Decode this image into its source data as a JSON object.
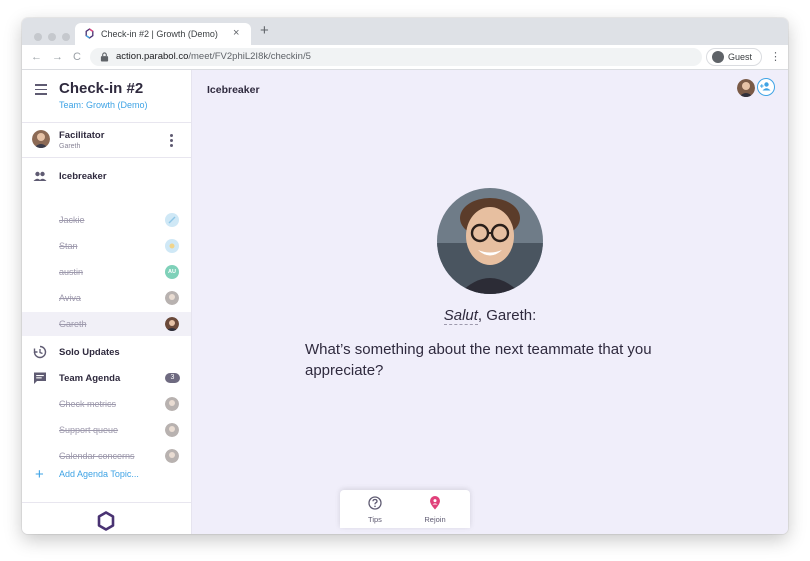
{
  "browser": {
    "tab_title": "Check-in #2 | Growth (Demo)",
    "tab_close": "×",
    "new_tab": "+",
    "back": "←",
    "forward": "→",
    "reload": "C",
    "url_host": "action.parabol.co",
    "url_path": "/meet/FV2phiL2I8k/checkin/5",
    "profile_label": "Guest",
    "menu": "⋮"
  },
  "sidebar": {
    "meeting_title": "Check-in #2",
    "team_name": "Team: Growth (Demo)",
    "facilitator_label": "Facilitator",
    "facilitator_name": "Gareth",
    "phases": {
      "icebreaker": "Icebreaker",
      "solo_updates": "Solo Updates",
      "team_agenda": "Team Agenda",
      "team_agenda_count": "3"
    },
    "icebreaker_members": [
      {
        "name": "Jackie",
        "avatar_color": "#cfe8f6"
      },
      {
        "name": "Stan",
        "avatar_color": "#cfe8f6"
      },
      {
        "name": "austin",
        "avatar_color": "#7fd1b9",
        "initials": "AU"
      },
      {
        "name": "Aviva",
        "avatar_color": "#b8b2b0"
      },
      {
        "name": "Gareth",
        "avatar_color": "#6b4a3a"
      }
    ],
    "agenda_items": [
      {
        "name": "Check metrics"
      },
      {
        "name": "Support queue"
      },
      {
        "name": "Calendar concerns"
      }
    ],
    "add_topic": "Add Agenda Topic...",
    "add_topic_icon": "+"
  },
  "main": {
    "phase_title": "Icebreaker",
    "greeting_word": "Salut",
    "greeting_rest": ", Gareth:",
    "question": "What’s something about the next teammate that you appreciate?",
    "bottom": {
      "tips_label": "Tips",
      "rejoin_label": "Rejoin"
    }
  },
  "colors": {
    "accent_blue": "#3ea3e5",
    "main_background": "#f0eefa",
    "rejoin_pink": "#e0407a"
  }
}
